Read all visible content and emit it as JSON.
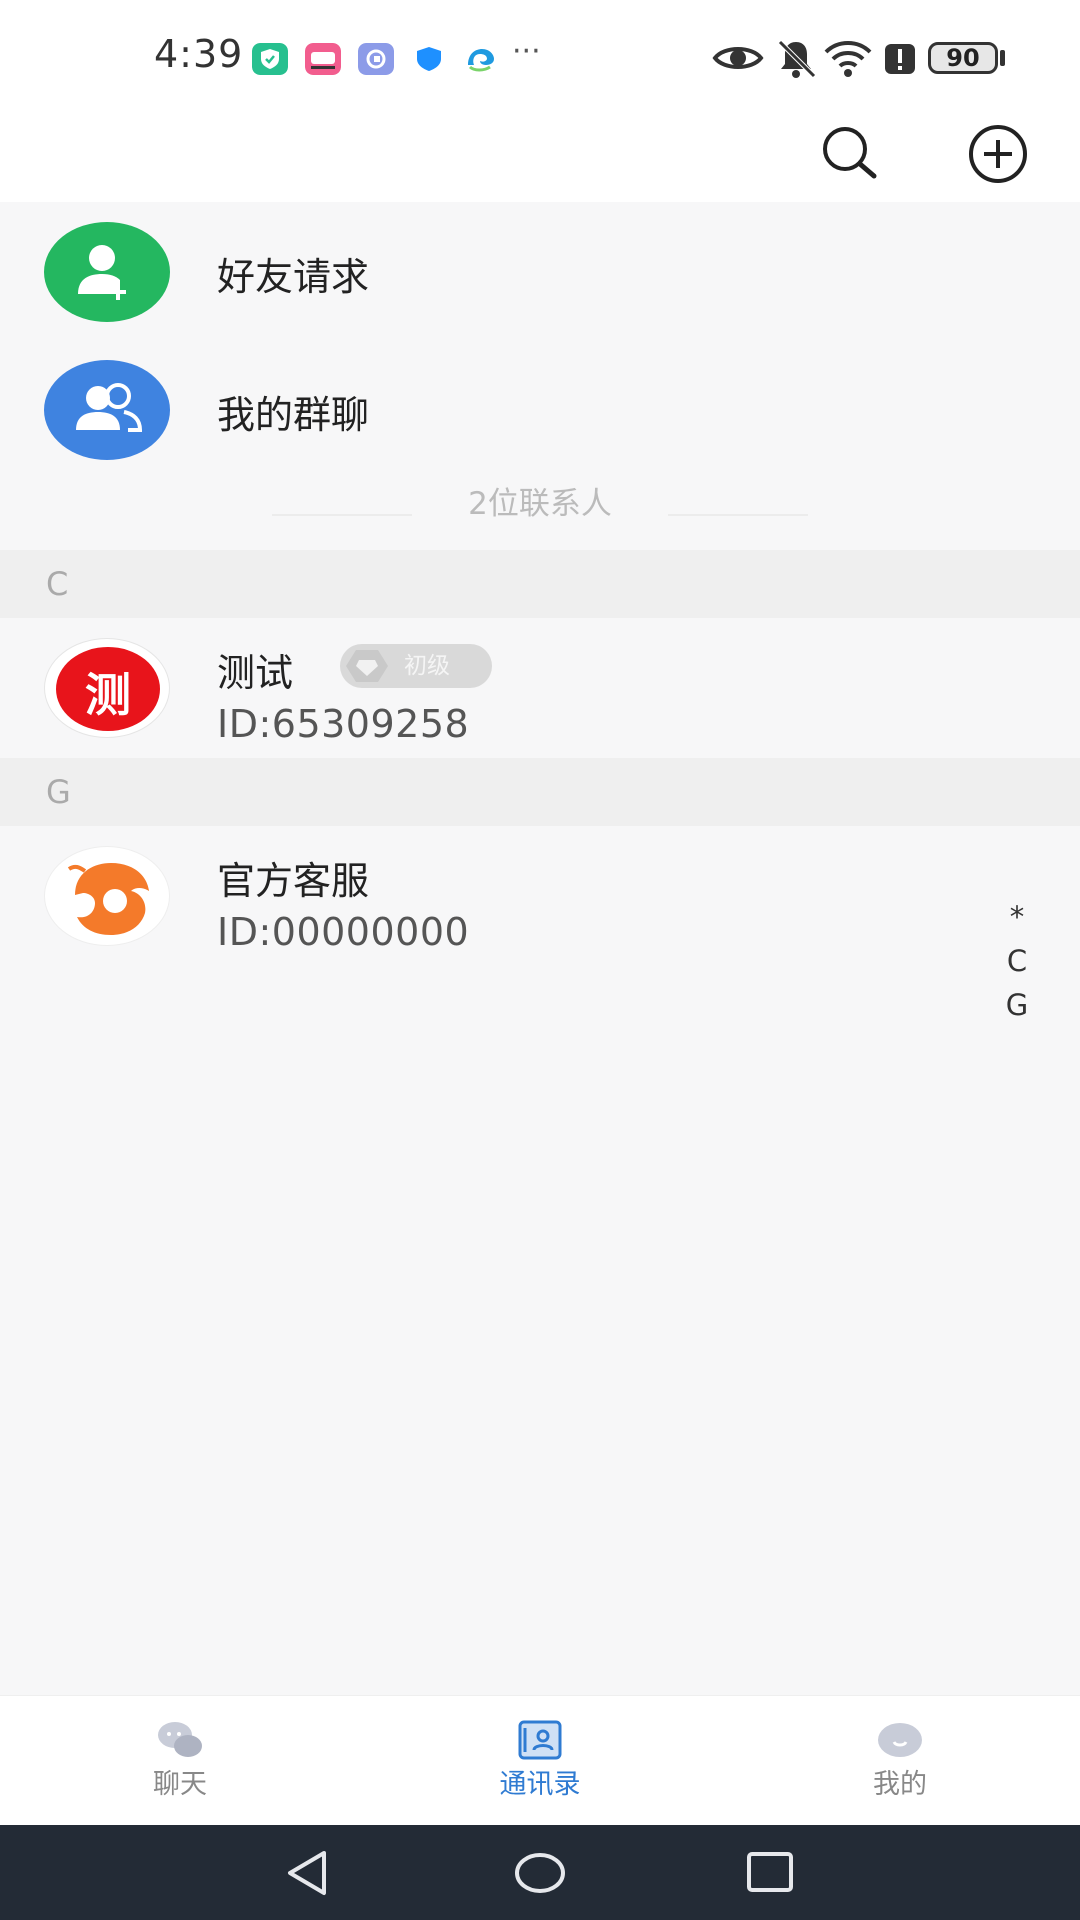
{
  "status_bar": {
    "time": "4:39",
    "battery": "90",
    "icons": [
      "shield-check-app-icon",
      "bilibili-app-icon",
      "chat-app-icon",
      "security-shield-icon",
      "browser-app-icon",
      "eye-icon",
      "bell-muted-icon",
      "wifi-icon",
      "alert-icon",
      "battery-icon"
    ],
    "overflow": "···"
  },
  "header": {
    "search_icon": "search-icon",
    "add_icon": "plus-circle-icon"
  },
  "shortcuts": [
    {
      "label": "好友请求",
      "icon": "add-friend-icon",
      "color": "#24b760"
    },
    {
      "label": "我的群聊",
      "icon": "group-icon",
      "color": "#3f83e0"
    }
  ],
  "contact_count": "2位联系人",
  "sections": [
    {
      "letter": "C",
      "contacts": [
        {
          "name": "测试",
          "id": "ID:65309258",
          "avatar_char": "测",
          "avatar_color": "#e8141b",
          "badge": "初级"
        }
      ]
    },
    {
      "letter": "G",
      "contacts": [
        {
          "name": "官方客服",
          "id": "ID:00000000",
          "avatar_color": "#f47a2a"
        }
      ]
    }
  ],
  "index_bar": [
    "*",
    "C",
    "G"
  ],
  "bottom_nav": {
    "items": [
      {
        "label": "聊天",
        "icon": "chat-bubbles-icon",
        "active": false
      },
      {
        "label": "通讯录",
        "icon": "contacts-book-icon",
        "active": true
      },
      {
        "label": "我的",
        "icon": "profile-face-icon",
        "active": false
      }
    ],
    "active_color": "#2f7bd2",
    "inactive_color": "#888888"
  },
  "system_nav": [
    "back-icon",
    "home-icon",
    "recents-icon"
  ]
}
